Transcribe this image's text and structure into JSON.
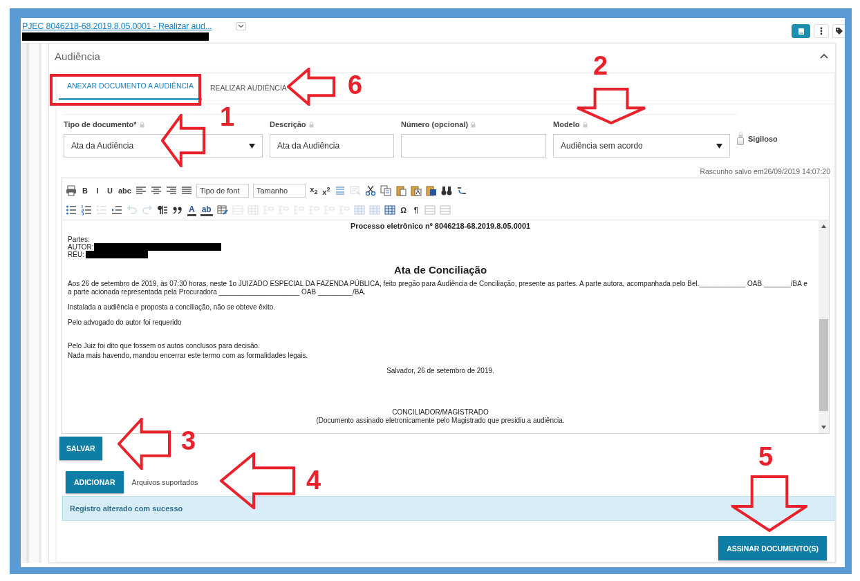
{
  "header": {
    "title": "PJEC 8046218-68.2019.8.05.0001 - Realizar aud..."
  },
  "panel": {
    "title": "Audiência"
  },
  "tabs": [
    {
      "label": "ANEXAR DOCUMENTO A AUDIÊNCIA",
      "selected": true
    },
    {
      "label": "REALIZAR AUDIÊNCIA",
      "selected": false
    }
  ],
  "form": {
    "document_type": {
      "label": "Tipo de documento*",
      "value": "Ata da Audiência"
    },
    "description": {
      "label": "Descrição",
      "value": "Ata da Audiência"
    },
    "number": {
      "label": "Número (opcional)"
    },
    "model": {
      "label": "Modelo",
      "value": "Audiência sem acordo"
    },
    "confidential": {
      "label": "Sigiloso",
      "checked": false
    }
  },
  "draft_status": "Rascunho salvo em26/09/2019 14:07:20",
  "toolbar": {
    "rows": [
      [
        {
          "kind": "icon",
          "disabled": false
        },
        {
          "kind": "glyph",
          "label": "B",
          "disabled": false
        },
        {
          "kind": "glyph",
          "label": "I",
          "disabled": false
        },
        {
          "kind": "glyph",
          "label": "U",
          "disabled": false
        },
        {
          "kind": "glyph",
          "label": "abc",
          "disabled": false
        },
        {
          "kind": "icon",
          "disabled": false
        },
        {
          "kind": "icon",
          "disabled": false
        },
        {
          "kind": "icon",
          "disabled": false
        },
        {
          "kind": "icon",
          "disabled": false
        },
        {
          "kind": "select",
          "label": "Tipo de font",
          "disabled": false
        },
        {
          "kind": "select",
          "label": "Tamanho",
          "disabled": false
        },
        {
          "kind": "glyph",
          "label": "x$_{2}$",
          "disabled": false
        },
        {
          "kind": "glyph",
          "label": "x$^{2}$",
          "disabled": false
        },
        {
          "kind": "icon",
          "disabled": false
        },
        {
          "kind": "icon",
          "disabled": true
        },
        {
          "kind": "icon",
          "disabled": false
        },
        {
          "kind": "icon",
          "disabled": false
        },
        {
          "kind": "icon",
          "disabled": false
        },
        {
          "kind": "icon",
          "disabled": false
        },
        {
          "kind": "icon",
          "disabled": false
        },
        {
          "kind": "icon",
          "disabled": false
        },
        {
          "kind": "icon",
          "disabled": false
        }
      ],
      [
        {
          "kind": "icon",
          "disabled": false
        },
        {
          "kind": "icon",
          "disabled": false
        },
        {
          "kind": "icon",
          "disabled": true
        },
        {
          "kind": "icon",
          "disabled": false
        },
        {
          "kind": "icon",
          "disabled": true
        },
        {
          "kind": "icon",
          "disabled": true
        },
        {
          "kind": "icon",
          "disabled": false
        },
        {
          "kind": "icon",
          "disabled": false
        },
        {
          "kind": "color",
          "label": "A",
          "disabled": false
        },
        {
          "kind": "color",
          "label": "ab",
          "disabled": false
        },
        {
          "kind": "icon",
          "disabled": false
        },
        {
          "kind": "icon",
          "disabled": true
        },
        {
          "kind": "icon",
          "disabled": true
        },
        {
          "kind": "icon",
          "disabled": true
        },
        {
          "kind": "icon",
          "disabled": true
        },
        {
          "kind": "icon",
          "disabled": true
        },
        {
          "kind": "icon",
          "disabled": true
        },
        {
          "kind": "icon",
          "disabled": true
        },
        {
          "kind": "icon",
          "disabled": true
        },
        {
          "kind": "icon",
          "disabled": true
        },
        {
          "kind": "icon",
          "disabled": true
        },
        {
          "kind": "icon",
          "disabled": false
        },
        {
          "kind": "glyph",
          "label": "Ω",
          "disabled": false
        },
        {
          "kind": "glyph",
          "label": "¶",
          "disabled": false
        },
        {
          "kind": "icon",
          "disabled": false
        },
        {
          "kind": "icon",
          "disabled": false
        }
      ]
    ]
  },
  "document": {
    "heading": "Processo eletrônico nº 8046218-68.2019.8.05.0001",
    "parties_label": "Partes:",
    "author_label": "AUTOR:",
    "defendant_label": "RÉU:",
    "title": "Ata de Conciliação",
    "paragraphs": [
      "Aos 26 de setembro de 2019, às 07:30 horas, neste 1o JUIZADO ESPECIAL DA FAZENDA PÚBLICA, feito pregão para Audiência de Conciliação, presente as partes. A parte autora, acompanhada pelo Bel.____________ OAB _______/BA e a parte acionada representada pela Procuradora _____________________ OAB _________/BA.",
      "Instalada a audiência e proposta a conciliação, não se obteve êxito.",
      "Pelo advogado do autor foi requerido",
      "Pelo Juiz foi dito que fossem os autos conclusos para decisão.",
      "Nada mais havendo, mandou encerrar este termo com as formalidades legais."
    ],
    "place_date": "Salvador, 26 de setembro de 2019.",
    "signature": "CONCILIADOR/MAGISTRADO",
    "signature_note": "(Documento assinado eletronicamente pelo Magistrado que presidiu a audiência."
  },
  "buttons": {
    "save": "SALVAR",
    "add": "ADICIONAR",
    "sign": "ASSINAR DOCUMENTO(S)"
  },
  "supported_files": "Arquivos suportados",
  "alert": "Registro alterado com sucesso",
  "annotations": [
    {
      "kind": "box"
    },
    {
      "kind": "arrow-left",
      "label": "6"
    },
    {
      "kind": "arrow-left",
      "label": "1"
    },
    {
      "kind": "arrow-down",
      "label": "2"
    },
    {
      "kind": "arrow-left",
      "label": "3"
    },
    {
      "kind": "arrow-left",
      "label": "4"
    },
    {
      "kind": "arrow-down",
      "label": "5"
    }
  ]
}
